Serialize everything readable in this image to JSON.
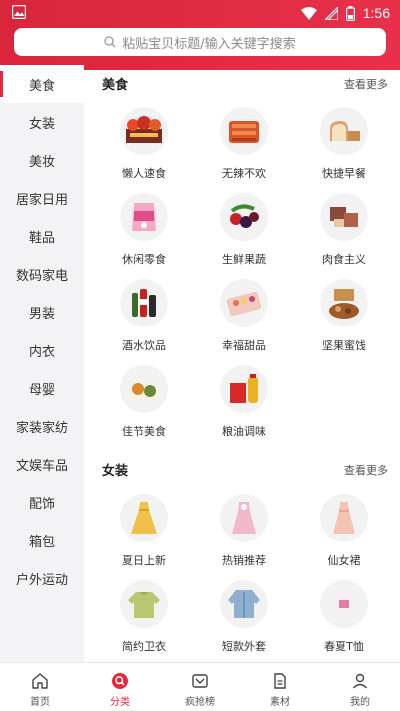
{
  "status": {
    "time": "1:56"
  },
  "search": {
    "placeholder": "粘贴宝贝标题/输入关键字搜索"
  },
  "sidebar": {
    "items": [
      {
        "label": "美食",
        "active": true
      },
      {
        "label": "女装"
      },
      {
        "label": "美妆"
      },
      {
        "label": "居家日用"
      },
      {
        "label": "鞋品"
      },
      {
        "label": "数码家电"
      },
      {
        "label": "男装"
      },
      {
        "label": "内衣"
      },
      {
        "label": "母婴"
      },
      {
        "label": "家装家纺"
      },
      {
        "label": "文娱车品"
      },
      {
        "label": "配饰"
      },
      {
        "label": "箱包"
      },
      {
        "label": "户外运动"
      }
    ]
  },
  "sections": [
    {
      "title": "美食",
      "more": "查看更多",
      "items": [
        {
          "label": "懒人速食",
          "icon": "instant-food-icon"
        },
        {
          "label": "无辣不欢",
          "icon": "spicy-food-icon"
        },
        {
          "label": "快捷早餐",
          "icon": "bread-icon"
        },
        {
          "label": "休闲零食",
          "icon": "snack-icon"
        },
        {
          "label": "生鲜果蔬",
          "icon": "fruit-icon"
        },
        {
          "label": "肉食主义",
          "icon": "meat-icon"
        },
        {
          "label": "酒水饮品",
          "icon": "drinks-icon"
        },
        {
          "label": "幸福甜品",
          "icon": "dessert-icon"
        },
        {
          "label": "坚果蜜饯",
          "icon": "nuts-icon"
        },
        {
          "label": "佳节美食",
          "icon": "festival-food-icon"
        },
        {
          "label": "粮油调味",
          "icon": "oil-icon"
        }
      ]
    },
    {
      "title": "女装",
      "more": "查看更多",
      "items": [
        {
          "label": "夏日上新",
          "icon": "yellow-dress-icon"
        },
        {
          "label": "热销推荐",
          "icon": "pink-dress-icon"
        },
        {
          "label": "仙女裙",
          "icon": "fairy-dress-icon"
        },
        {
          "label": "简约卫衣",
          "icon": "hoodie-icon"
        },
        {
          "label": "短款外套",
          "icon": "denim-jacket-icon"
        },
        {
          "label": "春夏T恤",
          "icon": "tshirt-icon"
        }
      ]
    }
  ],
  "bottom_nav": [
    {
      "label": "首页",
      "icon": "home-icon"
    },
    {
      "label": "分类",
      "icon": "category-search-icon",
      "active": true
    },
    {
      "label": "疯抢榜",
      "icon": "rank-icon"
    },
    {
      "label": "素材",
      "icon": "material-icon"
    },
    {
      "label": "我的",
      "icon": "user-icon"
    }
  ],
  "colors": {
    "accent": "#e3283f",
    "header_start": "#d9263b",
    "header_end": "#e8304a",
    "sidebar_bg": "#f3f3f5"
  }
}
